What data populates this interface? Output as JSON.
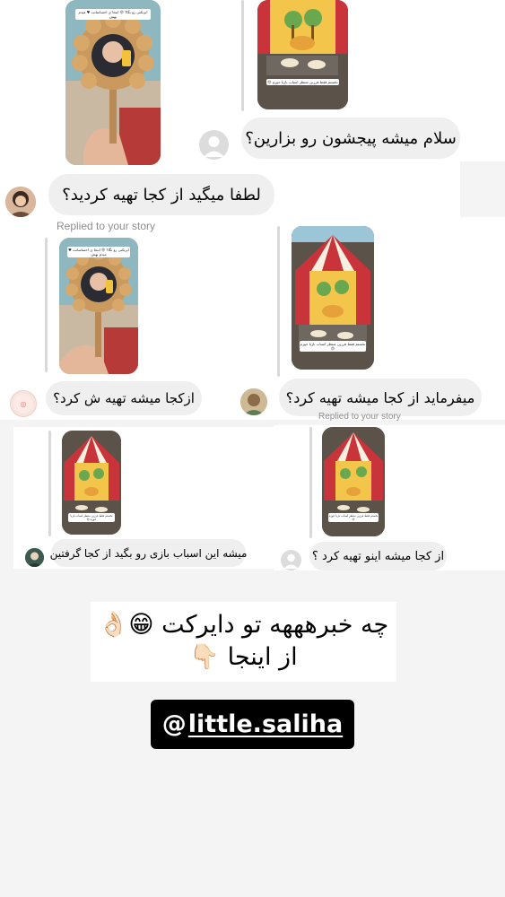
{
  "messages": {
    "m1": "سلام میشه پیجشون رو بزارین؟",
    "m2": "لطفا میگید از کجا تهیه کردید؟",
    "m3": "ازکجا میشه تهیه ش کرد؟",
    "m4": "میفرماید از کجا میشه تهیه کرد؟",
    "m5": "میشه این اسباب بازی رو بگید از کجا گرفتین",
    "m6": "از کجا میشه اینو تهیه کرد ؟"
  },
  "replied_label": "Replied to your story",
  "story_captions": {
    "mirror": "ابزبکنی رو نگا؟ 😜 اینجا ی احساساتت ♥ میدم بهش",
    "circus": "نخستم فقط فرزین منتظر اسباب بازیا جوزم 😍"
  },
  "promo": {
    "line1": "چه خبرهههه تو دایرکت 😁👌🏻",
    "line2": "از اینجا 👇🏻"
  },
  "handle": {
    "icon": "threads-icon",
    "glyph": "@",
    "text": "little.saliha"
  },
  "colors": {
    "bubble": "#efefef",
    "page_bg": "#f4f4f4",
    "tent_red": "#c8343a",
    "tent_yellow": "#f3c54a"
  }
}
